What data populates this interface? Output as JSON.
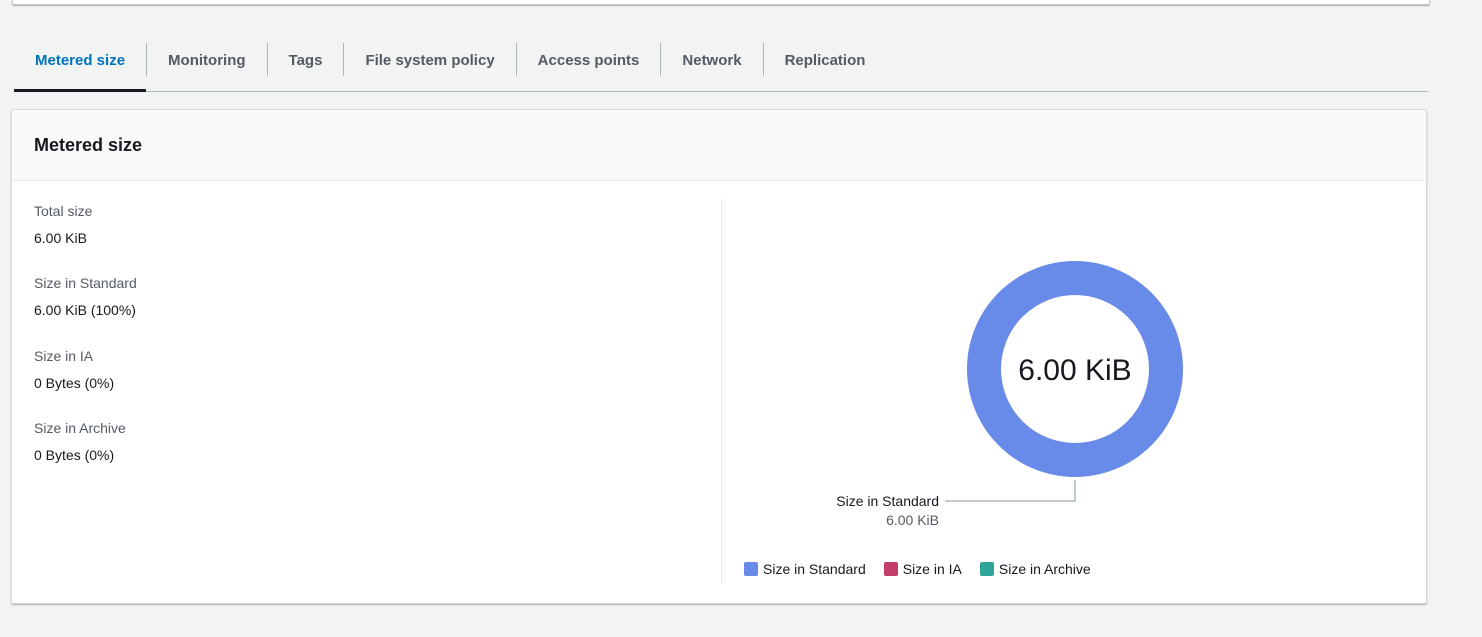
{
  "tabs": [
    {
      "label": "Metered size",
      "active": true
    },
    {
      "label": "Monitoring",
      "active": false
    },
    {
      "label": "Tags",
      "active": false
    },
    {
      "label": "File system policy",
      "active": false
    },
    {
      "label": "Access points",
      "active": false
    },
    {
      "label": "Network",
      "active": false
    },
    {
      "label": "Replication",
      "active": false
    }
  ],
  "panel": {
    "title": "Metered size",
    "fields": [
      {
        "key": "Total size",
        "value": "6.00 KiB"
      },
      {
        "key": "Size in Standard",
        "value": "6.00 KiB (100%)"
      },
      {
        "key": "Size in IA",
        "value": "0 Bytes (0%)"
      },
      {
        "key": "Size in Archive",
        "value": "0 Bytes (0%)"
      }
    ]
  },
  "chart_data": {
    "type": "pie",
    "center_label": "6.00 KiB",
    "categories": [
      "Size in Standard",
      "Size in IA",
      "Size in Archive"
    ],
    "values": [
      6.0,
      0,
      0
    ],
    "unit": "KiB",
    "colors": [
      "#688ae8",
      "#c33d69",
      "#2ea597"
    ],
    "callout": {
      "label": "Size in Standard",
      "value": "6.00 KiB"
    },
    "legend": "bottom"
  }
}
